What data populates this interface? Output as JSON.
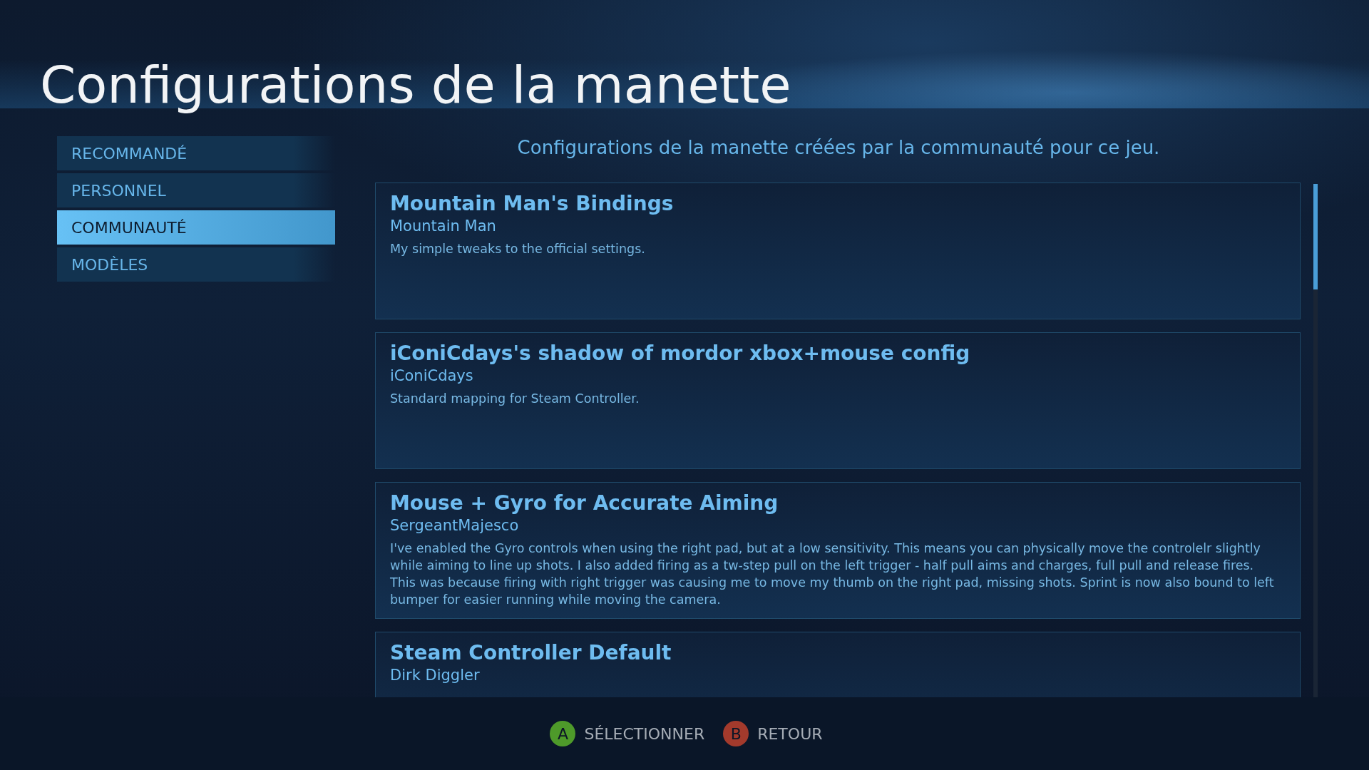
{
  "header": {
    "title": "Configurations de la manette"
  },
  "sidebar": {
    "items": [
      {
        "label": "RECOMMANDÉ",
        "selected": false
      },
      {
        "label": "PERSONNEL",
        "selected": false
      },
      {
        "label": "COMMUNAUTÉ",
        "selected": true
      },
      {
        "label": "MODÈLES",
        "selected": false
      }
    ]
  },
  "content": {
    "subtitle": "Configurations de la manette créées par la communauté pour ce jeu.",
    "configs": [
      {
        "title": "Mountain Man's Bindings",
        "author": "Mountain Man",
        "description": "My simple tweaks to the official settings."
      },
      {
        "title": "iConiCdays's shadow of mordor xbox+mouse config",
        "author": "iConiCdays",
        "description": "Standard mapping for Steam Controller."
      },
      {
        "title": "Mouse + Gyro for Accurate Aiming",
        "author": "SergeantMajesco",
        "description": "I've enabled the Gyro controls when using the right pad, but at a low sensitivity.  This means you can physically move the controlelr slightly while aiming to line up shots.  I also added firing as a tw-step pull on the left trigger - half pull aims and charges, full pull and release fires. This was because firing with right trigger was causing me to move my thumb on the right pad, missing shots.  Sprint is now also bound to left bumper for easier running while moving the camera."
      },
      {
        "title": "Steam Controller Default",
        "author": "Dirk Diggler"
      }
    ]
  },
  "footer": {
    "hints": [
      {
        "button": "A",
        "color": "#4e9a2a",
        "label": "SÉLECTIONNER"
      },
      {
        "button": "B",
        "color": "#a33a2c",
        "label": "RETOUR"
      }
    ]
  }
}
